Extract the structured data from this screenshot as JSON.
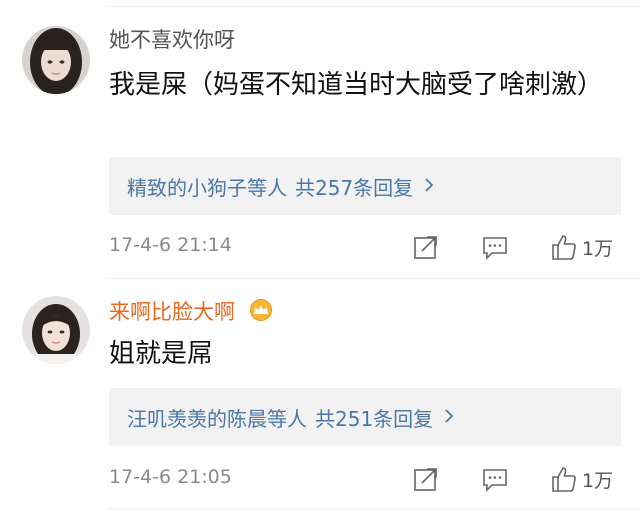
{
  "comments": [
    {
      "username": "她不喜欢你呀",
      "text": "我是屎（妈蛋不知道当时大脑受了啥刺激）",
      "reply_names": "精致的小狗子等人",
      "reply_count": "共257条回复",
      "timestamp": "17-4-6 21:14",
      "like_count": "1万"
    },
    {
      "username": "来啊比脸大啊",
      "text": "姐就是屌",
      "reply_names": "汪叽羡羡的陈晨等人",
      "reply_count": "共251条回复",
      "timestamp": "17-4-6 21:05",
      "like_count": "1万"
    }
  ],
  "colors": {
    "link": "#4b77a8",
    "vip_name": "#e8691f",
    "muted": "#8a8a8a",
    "reply_bg": "#f2f2f2"
  },
  "icons": {
    "share": "share-icon",
    "comment": "comment-icon",
    "like": "like-icon",
    "chevron": "chevron-right-icon",
    "crown": "crown-badge-icon"
  }
}
